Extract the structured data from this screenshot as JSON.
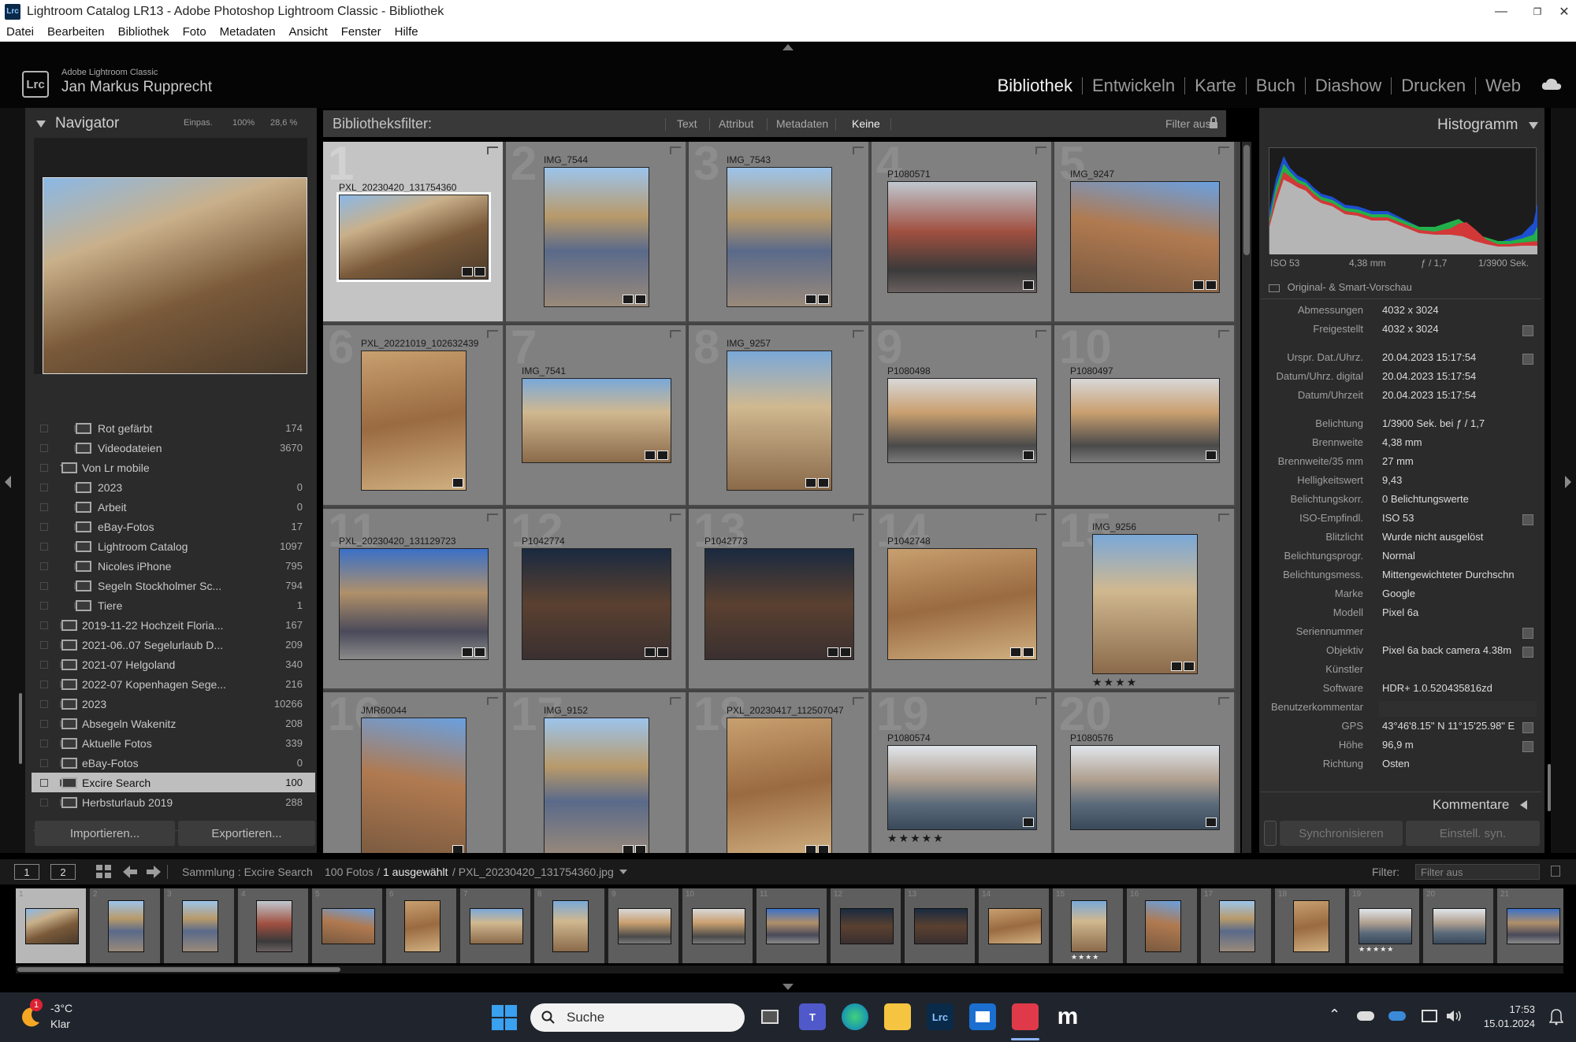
{
  "window": {
    "app_icon": "Lrc",
    "title": "Lightroom Catalog LR13 - Adobe Photoshop Lightroom Classic - Bibliothek",
    "minimize": "—",
    "maximize": "❐",
    "close": "✕"
  },
  "menu": [
    "Datei",
    "Bearbeiten",
    "Bibliothek",
    "Foto",
    "Metadaten",
    "Ansicht",
    "Fenster",
    "Hilfe"
  ],
  "identity": {
    "logo": "Lrc",
    "product": "Adobe Lightroom Classic",
    "user": "Jan Markus Rupprecht"
  },
  "modules": [
    "Bibliothek",
    "Entwickeln",
    "Karte",
    "Buch",
    "Diashow",
    "Drucken",
    "Web"
  ],
  "navigator": {
    "title": "Navigator",
    "zoom_options": [
      "Einpas.",
      "100%",
      "28,6 %"
    ]
  },
  "collections": [
    {
      "name": "Rot gefärbt",
      "count": "174",
      "level": 2,
      "type": "smart"
    },
    {
      "name": "Videodateien",
      "count": "3670",
      "level": 2,
      "type": "smart"
    },
    {
      "name": "Von Lr mobile",
      "count": "",
      "level": 1,
      "type": "set",
      "open": true
    },
    {
      "name": "2023",
      "count": "0",
      "level": 2,
      "type": "collection"
    },
    {
      "name": "Arbeit",
      "count": "0",
      "level": 2,
      "type": "collection"
    },
    {
      "name": "eBay-Fotos",
      "count": "17",
      "level": 2,
      "type": "collection"
    },
    {
      "name": "Lightroom Catalog",
      "count": "1097",
      "level": 2,
      "type": "collection"
    },
    {
      "name": "Nicoles iPhone",
      "count": "795",
      "level": 2,
      "type": "collection"
    },
    {
      "name": "Segeln Stockholmer Sc...",
      "count": "794",
      "level": 2,
      "type": "collection"
    },
    {
      "name": "Tiere",
      "count": "1",
      "level": 2,
      "type": "collection"
    },
    {
      "name": "2019-11-22 Hochzeit Floria...",
      "count": "167",
      "level": 1,
      "type": "collection"
    },
    {
      "name": "2021-06..07 Segelurlaub D...",
      "count": "209",
      "level": 1,
      "type": "collection"
    },
    {
      "name": "2021-07 Helgoland",
      "count": "340",
      "level": 1,
      "type": "collection"
    },
    {
      "name": "2022-07 Kopenhagen Sege...",
      "count": "216",
      "level": 1,
      "type": "collection"
    },
    {
      "name": "2023",
      "count": "10266",
      "level": 1,
      "type": "collection"
    },
    {
      "name": "Absegeln Wakenitz",
      "count": "208",
      "level": 1,
      "type": "collection"
    },
    {
      "name": "Aktuelle Fotos",
      "count": "339",
      "level": 1,
      "type": "collection"
    },
    {
      "name": "eBay-Fotos",
      "count": "0",
      "level": 1,
      "type": "collection"
    },
    {
      "name": "Excire Search",
      "count": "100",
      "level": 1,
      "type": "collection",
      "selected": true
    },
    {
      "name": "Herbsturlaub 2019",
      "count": "288",
      "level": 1,
      "type": "collection"
    }
  ],
  "left_buttons": {
    "import": "Importieren...",
    "export": "Exportieren..."
  },
  "filter_bar": {
    "title": "Bibliotheksfilter:",
    "items": [
      "Text",
      "Attribut",
      "Metadaten",
      "Keine"
    ],
    "active": "Keine",
    "preset": "Filter aus"
  },
  "grid": [
    {
      "num": "1",
      "name": "PXL_20230420_131754360",
      "orient": "land",
      "selected": true,
      "style": "p1",
      "badges": 2
    },
    {
      "num": "2",
      "name": "IMG_7544",
      "orient": "port",
      "style": "p2",
      "badges": 2
    },
    {
      "num": "3",
      "name": "IMG_7543",
      "orient": "port",
      "style": "p2",
      "badges": 2
    },
    {
      "num": "4",
      "name": "P1080571",
      "orient": "land-tall",
      "style": "p4",
      "badges": 1
    },
    {
      "num": "5",
      "name": "IMG_9247",
      "orient": "land-tall",
      "style": "p5",
      "badges": 2
    },
    {
      "num": "6",
      "name": "PXL_20221019_102632439",
      "orient": "port",
      "style": "p3",
      "badges": 1
    },
    {
      "num": "7",
      "name": "IMG_7541",
      "orient": "land",
      "style": "p9",
      "badges": 2
    },
    {
      "num": "8",
      "name": "IMG_9257",
      "orient": "port",
      "style": "p9",
      "badges": 2
    },
    {
      "num": "9",
      "name": "P1080498",
      "orient": "land",
      "style": "p6",
      "badges": 1
    },
    {
      "num": "10",
      "name": "P1080497",
      "orient": "land",
      "style": "p6",
      "badges": 1
    },
    {
      "num": "11",
      "name": "PXL_20230420_131129723",
      "orient": "land-tall",
      "style": "p7",
      "badges": 2
    },
    {
      "num": "12",
      "name": "P1042774",
      "orient": "land-tall",
      "style": "p8",
      "badges": 2
    },
    {
      "num": "13",
      "name": "P1042773",
      "orient": "land-tall",
      "style": "p8",
      "badges": 2
    },
    {
      "num": "14",
      "name": "P1042748",
      "orient": "land-tall",
      "style": "p3",
      "badges": 2
    },
    {
      "num": "15",
      "name": "IMG_9256",
      "orient": "port",
      "style": "p9",
      "badges": 2,
      "stars": "★★★★"
    },
    {
      "num": "16",
      "name": "JMR60044",
      "orient": "port",
      "style": "p5",
      "badges": 1
    },
    {
      "num": "17",
      "name": "IMG_9152",
      "orient": "port",
      "style": "p2",
      "badges": 2
    },
    {
      "num": "18",
      "name": "PXL_20230417_112507047",
      "orient": "port",
      "style": "p3",
      "badges": 2
    },
    {
      "num": "19",
      "name": "P1080574",
      "orient": "land",
      "style": "p10",
      "badges": 1,
      "stars": "★★★★★"
    },
    {
      "num": "20",
      "name": "P1080576",
      "orient": "land",
      "style": "p10",
      "badges": 1
    }
  ],
  "histogram": {
    "title": "Histogramm",
    "iso": "ISO 53",
    "focal": "4,38 mm",
    "aperture": "ƒ / 1,7",
    "shutter": "1/3900 Sek.",
    "smart_preview": "Original- & Smart-Vorschau"
  },
  "metadata": [
    {
      "label": "Abmessungen",
      "value": "4032 x 3024"
    },
    {
      "label": "Freigestellt",
      "value": "4032 x 3024",
      "go": true
    },
    {
      "label": "",
      "value": ""
    },
    {
      "label": "Urspr. Dat./Uhrz.",
      "value": "20.04.2023 15:17:54",
      "go": true
    },
    {
      "label": "Datum/Uhrz. digital",
      "value": "20.04.2023 15:17:54"
    },
    {
      "label": "Datum/Uhrzeit",
      "value": "20.04.2023 15:17:54"
    },
    {
      "label": "",
      "value": ""
    },
    {
      "label": "Belichtung",
      "value": "1/3900 Sek. bei ƒ / 1,7"
    },
    {
      "label": "Brennweite",
      "value": "4,38 mm"
    },
    {
      "label": "Brennweite/35 mm",
      "value": "27 mm"
    },
    {
      "label": "Helligkeitswert",
      "value": "9,43"
    },
    {
      "label": "Belichtungskorr.",
      "value": "0 Belichtungswerte"
    },
    {
      "label": "ISO-Empfindl.",
      "value": "ISO 53",
      "go": true
    },
    {
      "label": "Blitzlicht",
      "value": "Wurde nicht ausgelöst"
    },
    {
      "label": "Belichtungsprogr.",
      "value": "Normal"
    },
    {
      "label": "Belichtungsmess.",
      "value": "Mittengewichteter Durchschni..."
    },
    {
      "label": "Marke",
      "value": "Google"
    },
    {
      "label": "Modell",
      "value": "Pixel 6a"
    },
    {
      "label": "Seriennummer",
      "value": "",
      "go": true
    },
    {
      "label": "Objektiv",
      "value": "Pixel 6a back camera 4.38m",
      "go": true
    },
    {
      "label": "Künstler",
      "value": ""
    },
    {
      "label": "Software",
      "value": "HDR+ 1.0.520435816zd"
    },
    {
      "label": "Benutzerkommentar",
      "value": "",
      "box": true
    },
    {
      "label": "GPS",
      "value": "43°46'8.15\" N 11°15'25.98\" E",
      "go": true
    },
    {
      "label": "Höhe",
      "value": "96,9 m",
      "go": true
    },
    {
      "label": "Richtung",
      "value": "Osten"
    }
  ],
  "right_footer": {
    "comments": "Kommentare",
    "sync": "Synchronisieren",
    "set_sync": "Einstell. syn."
  },
  "filmstrip_bar": {
    "view1": "1",
    "view2": "2",
    "source": "Sammlung : Excire Search",
    "count": "100 Fotos /",
    "selected": "1 ausgewählt",
    "file": "/ PXL_20230420_131754360.jpg",
    "filter_label": "Filter:",
    "filter_value": "Filter aus"
  },
  "filmstrip": [
    {
      "num": "1",
      "style": "p1",
      "orient": "land",
      "selected": true
    },
    {
      "num": "2",
      "style": "p2",
      "orient": "port"
    },
    {
      "num": "3",
      "style": "p2",
      "orient": "port"
    },
    {
      "num": "4",
      "style": "p4",
      "orient": "port"
    },
    {
      "num": "5",
      "style": "p5",
      "orient": "land"
    },
    {
      "num": "6",
      "style": "p3",
      "orient": "port"
    },
    {
      "num": "7",
      "style": "p9",
      "orient": "land"
    },
    {
      "num": "8",
      "style": "p9",
      "orient": "port"
    },
    {
      "num": "9",
      "style": "p6",
      "orient": "land"
    },
    {
      "num": "10",
      "style": "p6",
      "orient": "land"
    },
    {
      "num": "11",
      "style": "p7",
      "orient": "land"
    },
    {
      "num": "12",
      "style": "p8",
      "orient": "land"
    },
    {
      "num": "13",
      "style": "p8",
      "orient": "land"
    },
    {
      "num": "14",
      "style": "p3",
      "orient": "land"
    },
    {
      "num": "15",
      "style": "p9",
      "orient": "port",
      "stars": "★★★★"
    },
    {
      "num": "16",
      "style": "p5",
      "orient": "port"
    },
    {
      "num": "17",
      "style": "p2",
      "orient": "port"
    },
    {
      "num": "18",
      "style": "p3",
      "orient": "port"
    },
    {
      "num": "19",
      "style": "p10",
      "orient": "land",
      "stars": "★★★★★"
    },
    {
      "num": "20",
      "style": "p10",
      "orient": "land"
    },
    {
      "num": "21",
      "style": "p7",
      "orient": "land"
    }
  ],
  "taskbar": {
    "weather_badge": "1",
    "temp": "-3°C",
    "condition": "Klar",
    "search": "Suche",
    "apps": [
      "start-icon",
      "task-view-icon",
      "teams-icon",
      "edge-icon",
      "explorer-icon",
      "lightroom-icon",
      "store-icon",
      "snipping-icon",
      "mastodon-icon"
    ],
    "lrc_label": "Lrc",
    "mastodon_label": "m",
    "tray_chevron": "⌃",
    "time": "17:53",
    "date": "15.01.2024"
  },
  "colors": {
    "panel": "#2b2b2b",
    "grid_cell": "#808080",
    "selected_cell": "#c4c4c4",
    "accent_module": "#f2f2f2"
  }
}
